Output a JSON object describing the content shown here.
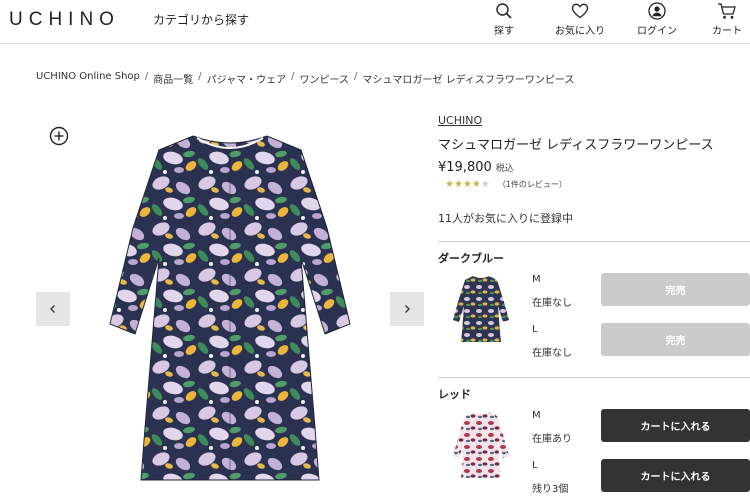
{
  "header": {
    "logo": "UCHINO",
    "category_search": "カテゴリから探す",
    "nav": [
      {
        "label": "探す",
        "icon": "search-icon"
      },
      {
        "label": "お気に入り",
        "icon": "heart-icon"
      },
      {
        "label": "ログイン",
        "icon": "user-icon"
      },
      {
        "label": "カート",
        "icon": "cart-icon"
      }
    ]
  },
  "breadcrumb": [
    "UCHINO Online Shop",
    "商品一覧",
    "パジャマ・ウェア",
    "ワンピース",
    "マシュマロガーゼ レディスフラワーワンピース"
  ],
  "product": {
    "brand": "UCHINO",
    "name": "マシュマロガーゼ レディスフラワーワンピース",
    "price": "¥19,800",
    "tax_label": "税込",
    "rating": 4,
    "rating_max": 5,
    "review_count": "（1件のレビュー）",
    "favorites": "11人がお気に入りに登録中"
  },
  "variants": [
    {
      "color": "ダークブルー",
      "sizes": [
        {
          "size": "M",
          "stock": "在庫なし",
          "button": "完売",
          "available": false
        },
        {
          "size": "L",
          "stock": "在庫なし",
          "button": "完売",
          "available": false
        }
      ]
    },
    {
      "color": "レッド",
      "sizes": [
        {
          "size": "M",
          "stock": "在庫あり",
          "button": "カートに入れる",
          "available": true
        },
        {
          "size": "L",
          "stock": "残り3個",
          "button": "カートに入れる",
          "available": true
        }
      ]
    }
  ],
  "colors": {
    "soldout_button": "#cbcbcb",
    "cart_button": "#333333",
    "star_active": "#c9b44a",
    "star_inactive": "#cfcfcf"
  }
}
